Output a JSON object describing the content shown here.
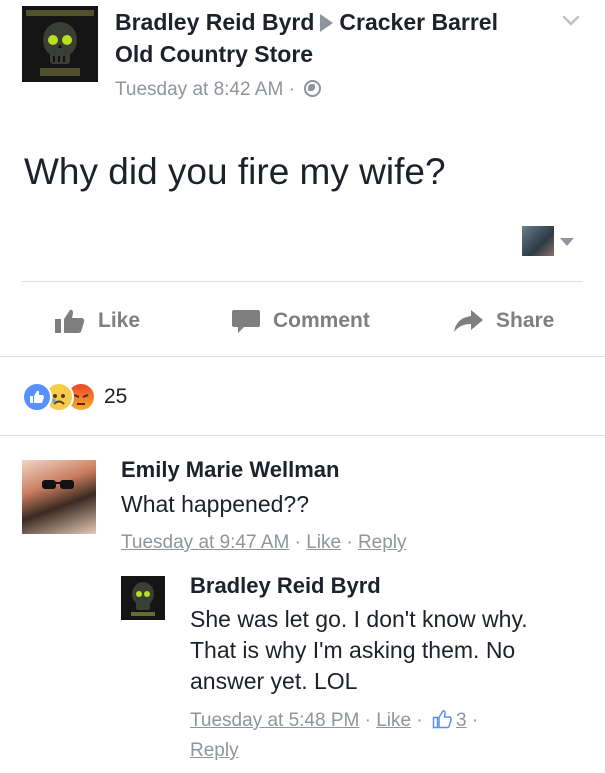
{
  "post": {
    "author": "Bradley Reid Byrd",
    "target": "Cracker Barrel Old Country Store",
    "timestamp": "Tuesday at 8:42 AM",
    "separator": "·",
    "text": "Why did you fire my wife?"
  },
  "actions": {
    "like": "Like",
    "comment": "Comment",
    "share": "Share"
  },
  "reactions": {
    "types": [
      "like",
      "sad",
      "angry"
    ],
    "count": "25"
  },
  "comments": [
    {
      "author": "Emily Marie Wellman",
      "text": "What happened??",
      "timestamp": "Tuesday at 9:47 AM",
      "like": "Like",
      "reply": "Reply"
    }
  ],
  "reply": {
    "author": "Bradley Reid Byrd",
    "text": "She was let go. I don't know why. That is why I'm asking them. No answer yet. LOL",
    "timestamp": "Tuesday at 5:48 PM",
    "like": "Like",
    "like_count": "3",
    "reply": "Reply"
  },
  "colors": {
    "text": "#1d2129",
    "muted": "#90949c",
    "like_blue": "#5890ff",
    "angry_red": "#e9710f",
    "sad_yellow": "#f7cc4a"
  }
}
